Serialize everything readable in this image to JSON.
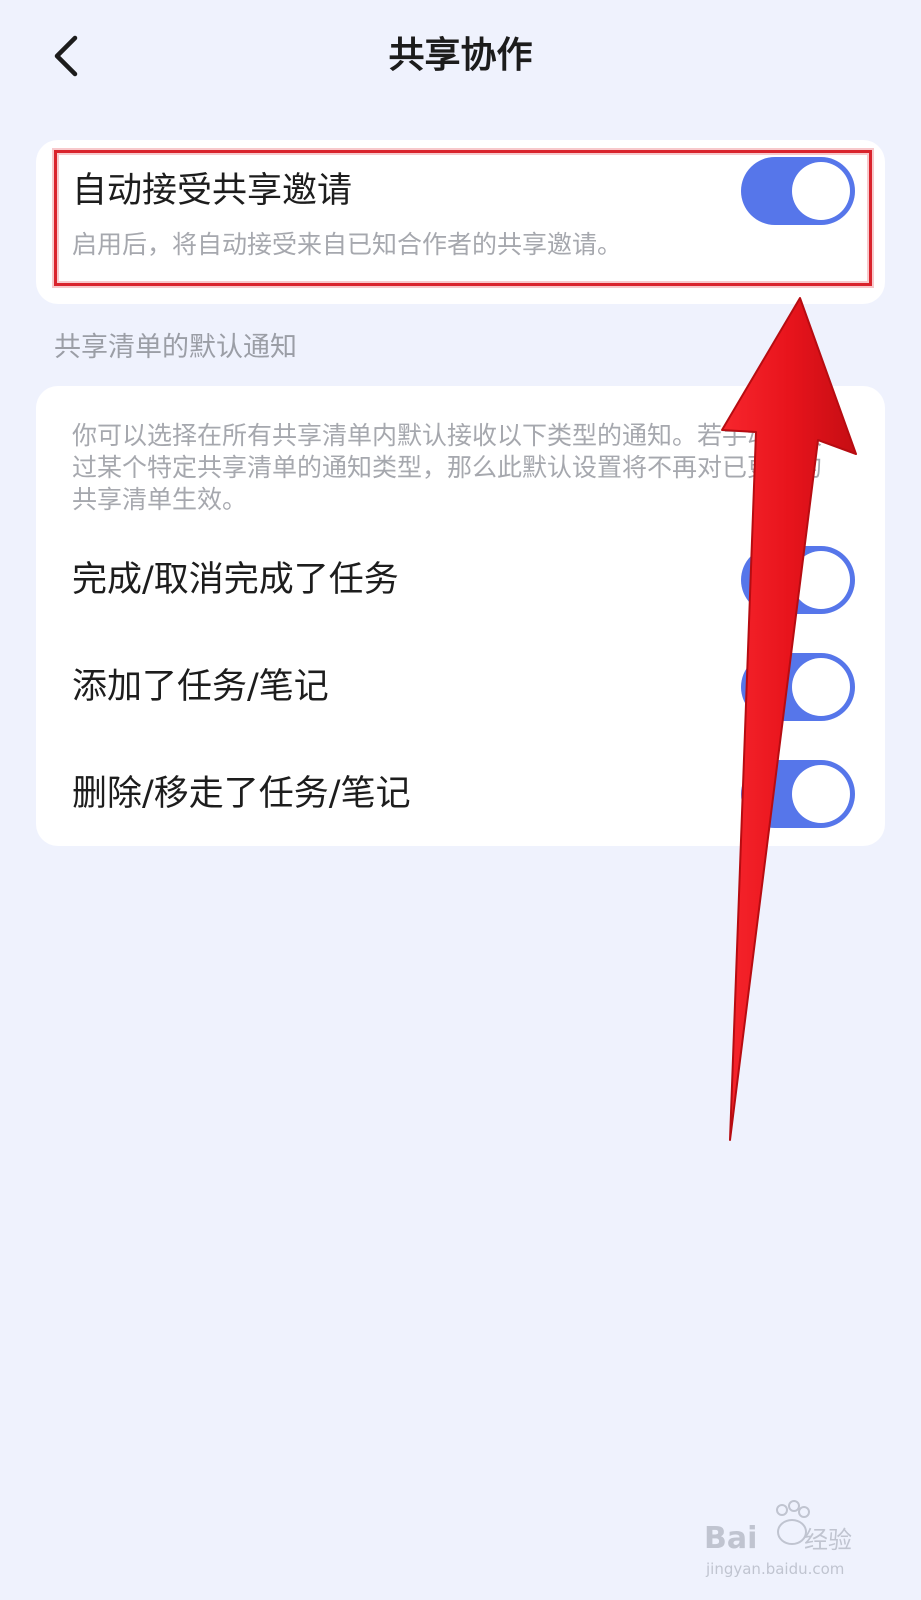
{
  "header": {
    "title": "共享协作",
    "back_icon": "chevron-left-icon"
  },
  "auto_accept": {
    "title": "自动接受共享邀请",
    "description": "启用后，将自动接受来自已知合作者的共享邀请。",
    "enabled": true
  },
  "notifications": {
    "section_label": "共享清单的默认通知",
    "description": "你可以选择在所有共享清单内默认接收以下类型的通知。若手动更改过某个特定共享清单的通知类型，那么此默认设置将不再对已更改的共享清单生效。",
    "items": [
      {
        "label": "完成/取消完成了任务",
        "enabled": true
      },
      {
        "label": "添加了任务/笔记",
        "enabled": true
      },
      {
        "label": "删除/移走了任务/笔记",
        "enabled": true
      }
    ]
  },
  "colors": {
    "toggle_on": "#5676ea",
    "background": "#eff2fd",
    "highlight": "#d9232c",
    "arrow": "#e8141c"
  },
  "watermark": {
    "brand": "Bai du 经验",
    "url": "jingyan.baidu.com"
  }
}
